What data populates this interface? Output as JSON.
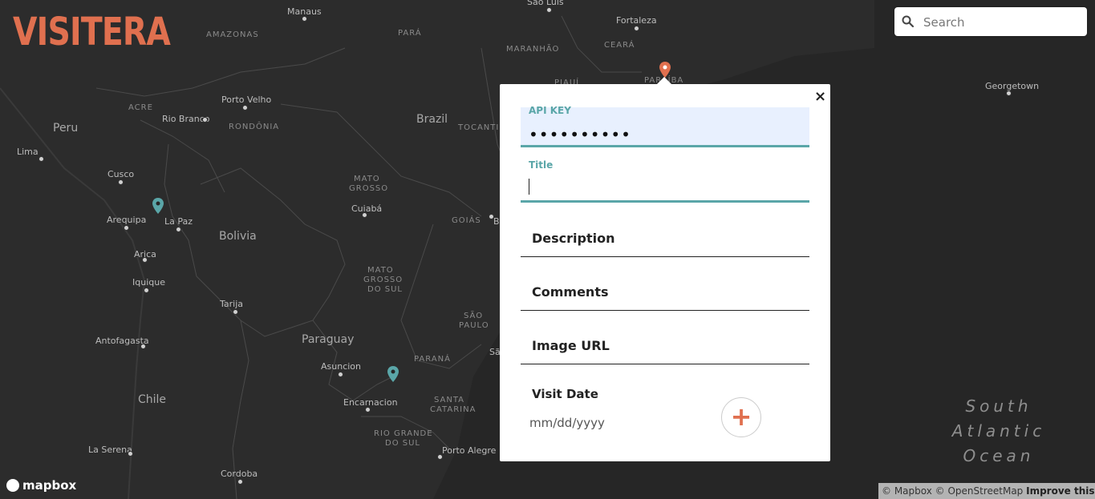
{
  "app": {
    "logo": "VISITERA"
  },
  "search": {
    "placeholder": "Search"
  },
  "map": {
    "countries": [
      "Peru",
      "Brazil",
      "Bolivia",
      "Paraguay",
      "Chile"
    ],
    "regions": [
      "AMAZONAS",
      "PARÁ",
      "MARANHÃO",
      "CEARÁ",
      "ACRE",
      "RONDÔNIA",
      "TOCANTINS",
      "MATO",
      "GROSSO",
      "GOIÁS",
      "MATO",
      "GROSSO",
      "DO SUL",
      "SÃO",
      "PAULO",
      "PARANÁ",
      "SANTA",
      "CATARINA",
      "RIO GRANDE",
      "DO SUL",
      "PARAÍBA",
      "PIAUÍ"
    ],
    "cities": [
      "São Luís",
      "Manaus",
      "Fortaleza",
      "Porto Velho",
      "Rio Branco",
      "Lima",
      "Cusco",
      "Arequipa",
      "La Paz",
      "Cuiabá",
      "Arica",
      "Iquique",
      "Tarija",
      "Antofagasta",
      "Asuncion",
      "Encarnacion",
      "Porto Alegre",
      "La Serena",
      "Cordoba",
      "Georgetown",
      "Sã",
      "B"
    ],
    "ocean_label": [
      "South",
      "Atlantic",
      "Ocean"
    ]
  },
  "popup": {
    "close_label": "×",
    "api_key": {
      "label": "API KEY",
      "value": "••••••••••"
    },
    "title": {
      "label": "Title",
      "value": ""
    },
    "description": {
      "label": "Description"
    },
    "comments": {
      "label": "Comments"
    },
    "image_url": {
      "label": "Image URL"
    },
    "visit_date": {
      "label": "Visit Date",
      "placeholder": "mm/dd/yyyy"
    },
    "add_label": "+"
  },
  "footer": {
    "mapbox_logo": "mapbox",
    "attribution": "© Mapbox © OpenStreetMap",
    "improve": "Improve this map"
  },
  "colors": {
    "accent": "#e0704f",
    "teal": "#5aa6a8",
    "map_bg": "#262626"
  }
}
